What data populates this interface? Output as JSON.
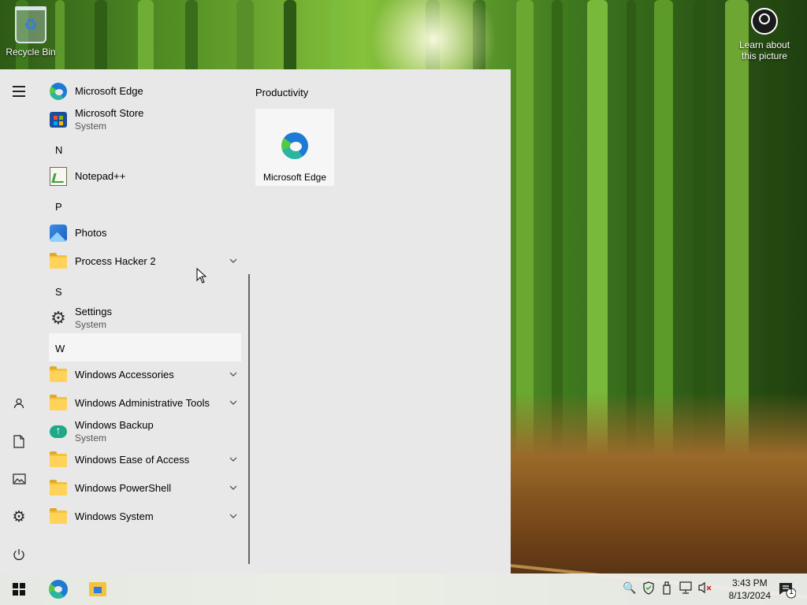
{
  "desktop": {
    "recycle_bin": "Recycle Bin",
    "learn_line1": "Learn about",
    "learn_line2": "this picture"
  },
  "start_menu": {
    "apps": [
      {
        "name": "Microsoft Edge"
      },
      {
        "name": "Microsoft Store",
        "sub": "System"
      },
      {
        "letter": "N"
      },
      {
        "name": "Notepad++"
      },
      {
        "letter": "P"
      },
      {
        "name": "Photos"
      },
      {
        "name": "Process Hacker 2"
      },
      {
        "letter": "S"
      },
      {
        "name": "Settings",
        "sub": "System"
      },
      {
        "letter": "W"
      },
      {
        "name": "Windows Accessories"
      },
      {
        "name": "Windows Administrative Tools"
      },
      {
        "name": "Windows Backup",
        "sub": "System"
      },
      {
        "name": "Windows Ease of Access"
      },
      {
        "name": "Windows PowerShell"
      },
      {
        "name": "Windows System"
      }
    ],
    "tile_group": "Productivity",
    "tiles": [
      {
        "name": "Microsoft Edge"
      }
    ]
  },
  "taskbar": {
    "time": "3:43 PM",
    "date": "8/13/2024",
    "notification_count": "1"
  }
}
